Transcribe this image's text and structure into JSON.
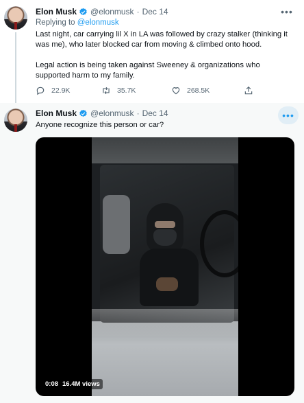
{
  "tweets": [
    {
      "name": "Elon Musk",
      "handle": "@elonmusk",
      "dot": "·",
      "date": "Dec 14",
      "replying_prefix": "Replying to",
      "replying_handle": "@elonmusk",
      "paragraphs": [
        "Last night, car carrying lil X in LA was followed by crazy stalker (thinking it was me), who later blocked car from moving & climbed onto hood.",
        "Legal action is being taken against Sweeney & organizations who supported harm to my family."
      ],
      "replies": "22.9K",
      "retweets": "35.7K",
      "likes": "268.5K"
    },
    {
      "name": "Elon Musk",
      "handle": "@elonmusk",
      "dot": "·",
      "date": "Dec 14",
      "text": "Anyone recognize this person or car?",
      "video": {
        "time": "0:08",
        "views": "16.4M views"
      }
    }
  ],
  "colors": {
    "accent": "#1d9bf0",
    "muted": "#536471",
    "text": "#0f1419",
    "highlight_bg": "#f7f9f9"
  },
  "icons": [
    "verified-badge-icon",
    "more-icon",
    "reply-icon",
    "retweet-icon",
    "like-icon",
    "share-icon",
    "avatar"
  ]
}
